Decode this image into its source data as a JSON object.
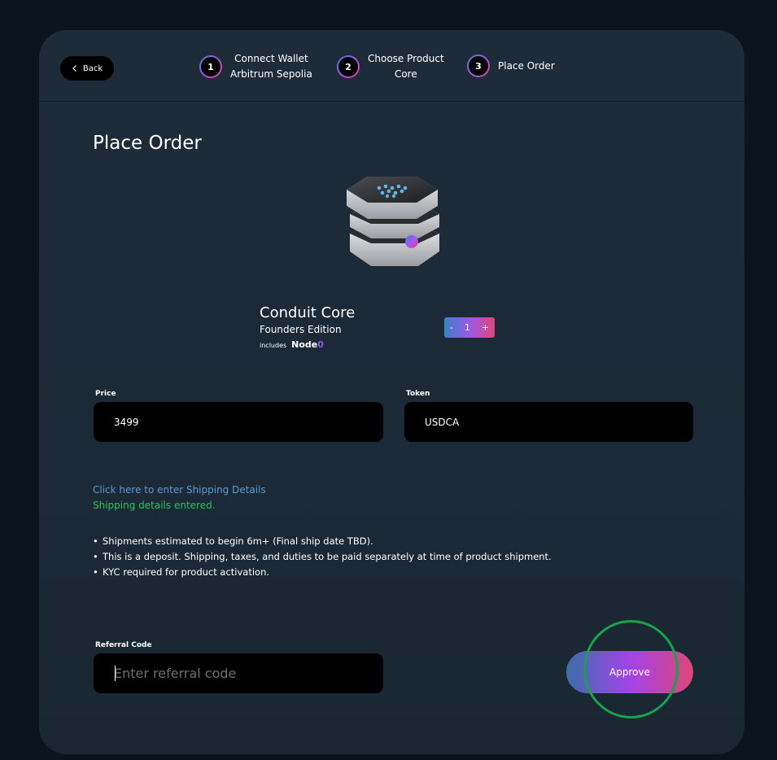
{
  "header": {
    "back_label": "Back",
    "steps": [
      {
        "number": "1",
        "label_line1": "Connect Wallet",
        "label_line2": "Arbitrum Sepolia"
      },
      {
        "number": "2",
        "label_line1": "Choose Product",
        "label_line2": "Core"
      },
      {
        "number": "3",
        "label_line1": "Place Order",
        "label_line2": ""
      }
    ]
  },
  "main": {
    "title": "Place Order",
    "product": {
      "name": "Conduit Core",
      "edition": "Founders Edition",
      "includes_label": "includes",
      "includes_node": "Node",
      "includes_node_suffix": "0"
    },
    "quantity": {
      "minus": "-",
      "value": "1",
      "plus": "+"
    },
    "price": {
      "label": "Price",
      "value": "3499"
    },
    "token": {
      "label": "Token",
      "value": "USDCA"
    },
    "shipping": {
      "link_text": "Click here to enter Shipping Details",
      "status_text": "Shipping details entered."
    },
    "notes": [
      "Shipments estimated to begin 6m+ (Final ship date TBD).",
      "This is a deposit. Shipping, taxes, and duties to be paid separately at time of product shipment.",
      "KYC required for product activation."
    ],
    "referral": {
      "label": "Referral Code",
      "placeholder": "Enter referral code"
    },
    "approve_label": "Approve"
  },
  "icons": {
    "back": "chevron-left-icon"
  },
  "colors": {
    "accent_blue": "#3b82c4",
    "accent_purple": "#a855f7",
    "accent_pink": "#e0457b",
    "link": "#5b9bd5",
    "success": "#22c55e",
    "highlight": "#16a34a"
  }
}
